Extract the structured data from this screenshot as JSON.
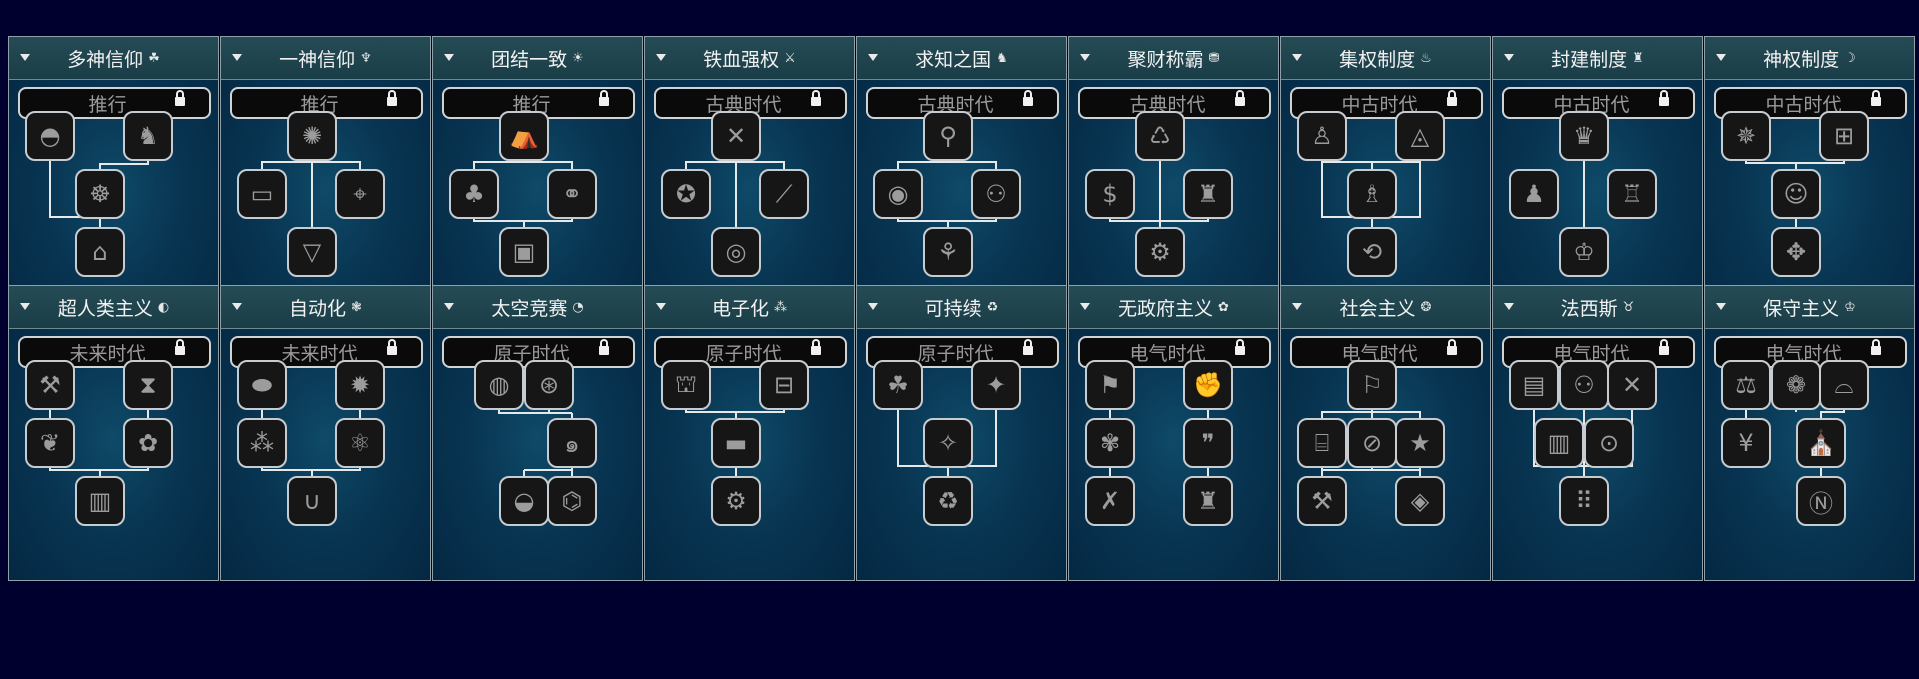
{
  "rows": [
    {
      "cards": [
        {
          "title": "多神信仰",
          "title_icon": "☘",
          "era": "推行",
          "icons": [
            "sunrise-temple-icon",
            "sphinx-icon",
            "dharma-wheel-icon",
            "pantheon-temple-icon"
          ]
        },
        {
          "title": "一神信仰",
          "title_icon": "♆",
          "era": "推行",
          "icons": [
            "altar-icon",
            "scroll-icon",
            "telescope-icon",
            "triquetra-icon"
          ]
        },
        {
          "title": "团结一致",
          "title_icon": "☀",
          "era": "推行",
          "icons": [
            "tent-icon",
            "forest-icon",
            "handshake-deal-icon",
            "holy-book-icon"
          ]
        },
        {
          "title": "铁血强权",
          "title_icon": "⚔",
          "era": "古典时代",
          "icons": [
            "crossed-swords-icon",
            "lion-head-icon",
            "curved-sword-icon",
            "shield-emblem-icon"
          ]
        },
        {
          "title": "求知之国",
          "title_icon": "♞",
          "era": "古典时代",
          "icons": [
            "location-pin-icon",
            "intersect-circles-icon",
            "people-group-icon",
            "trophy-people-icon"
          ]
        },
        {
          "title": "聚财称霸",
          "title_icon": "⛃",
          "era": "古典时代",
          "icons": [
            "handshake-circle-icon",
            "money-bag-icon",
            "top-hat-icon",
            "gear-coin-icon"
          ]
        },
        {
          "title": "集权制度",
          "title_icon": "♨",
          "era": "中古时代",
          "icons": [
            "throne-figure-icon",
            "eye-pyramid-icon",
            "reading-figure-icon",
            "rotate-home-icon"
          ]
        },
        {
          "title": "封建制度",
          "title_icon": "♜",
          "era": "中古时代",
          "icons": [
            "royal-court-icon",
            "bowing-figure-icon",
            "castle-icon",
            "crown-icon"
          ]
        },
        {
          "title": "神权制度",
          "title_icon": "☽",
          "era": "中古时代",
          "icons": [
            "clergy-icon",
            "gift-icon",
            "robed-figure-icon",
            "sacred-tree-icon"
          ]
        }
      ]
    },
    {
      "cards": [
        {
          "title": "超人类主义",
          "title_icon": "◐",
          "era": "未来时代",
          "icons": [
            "robot-arm-icon",
            "dna-icon",
            "fruit-icon",
            "brain-icon",
            "scroll-flag-icon"
          ]
        },
        {
          "title": "自动化",
          "title_icon": "❃",
          "era": "未来时代",
          "icons": [
            "capsule-icon",
            "lightbulb-gear-icon",
            "network-people-icon",
            "molecule-icon",
            "magnet-icon"
          ]
        },
        {
          "title": "太空竞赛",
          "title_icon": "◔",
          "era": "原子时代",
          "icons": [
            "atom-ring-icon",
            "satellite-badge-icon",
            "galaxy-icon",
            "globe-rocket-icon",
            "graduation-cap-icon"
          ]
        },
        {
          "title": "电子化",
          "title_icon": "⁂",
          "era": "原子时代",
          "icons": [
            "bank-icon",
            "circuit-board-icon",
            "computer-icon",
            "folder-gear-icon"
          ]
        },
        {
          "title": "可持续",
          "title_icon": "♻",
          "era": "原子时代",
          "icons": [
            "plant-hand-icon",
            "lightbulb-icon",
            "sparkle-water-icon",
            "recycle-arrow-icon"
          ]
        },
        {
          "title": "无政府主义",
          "title_icon": "✿",
          "era": "电气时代",
          "icons": [
            "torch-icon",
            "raised-fist-icon",
            "wheat-icon",
            "speech-bubbles-icon",
            "crossed-tools-icon",
            "parliament-icon"
          ]
        },
        {
          "title": "社会主义",
          "title_icon": "❂",
          "era": "电气时代",
          "icons": [
            "wheat-flag-icon",
            "state-factory-icon",
            "no-money-icon",
            "star-people-icon",
            "hammer-tool-icon",
            "badge-diamond-icon"
          ]
        },
        {
          "title": "法西斯",
          "title_icon": "♉",
          "era": "电气时代",
          "icons": [
            "newspaper-icon",
            "meeting-icon",
            "windmill-icon",
            "prison-icon",
            "magnify-eye-icon",
            "marching-figures-icon"
          ]
        },
        {
          "title": "保守主义",
          "title_icon": "♔",
          "era": "电气时代",
          "icons": [
            "scales-icon",
            "rose-emblem-icon",
            "assembly-icon",
            "money-hand-icon",
            "bank-building-icon",
            "no-entry-icon"
          ]
        }
      ]
    }
  ]
}
